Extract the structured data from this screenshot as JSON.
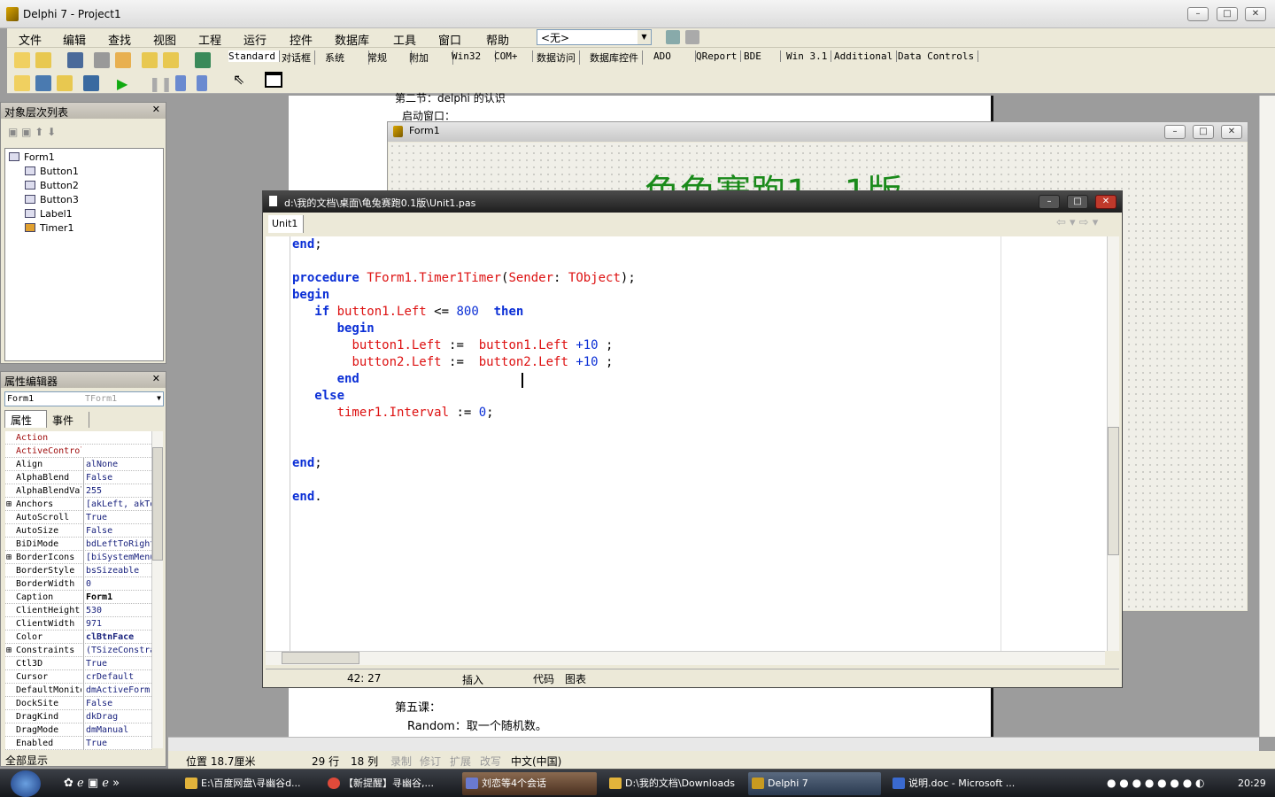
{
  "window": {
    "title": "Delphi 7 - Project1"
  },
  "menu": [
    "文件",
    "编辑",
    "查找",
    "视图",
    "工程",
    "运行",
    "控件",
    "数据库",
    "工具",
    "窗口",
    "帮助"
  ],
  "combo_value": "<无>",
  "palette_tabs": [
    "Standard",
    "对话框",
    "系统",
    "常规",
    "附加",
    "Win32",
    "COM+",
    "数据访问",
    "数据库控件",
    "ADO",
    "QReport",
    "BDE",
    "Win 3.1",
    "Additional",
    "Data Controls"
  ],
  "tree": {
    "title": "对象层次列表",
    "items": [
      "Form1",
      "Button1",
      "Button2",
      "Button3",
      "Label1",
      "Timer1"
    ]
  },
  "inspector": {
    "title": "属性编辑器",
    "object": "Form1",
    "object_type": "TForm1",
    "tabs": [
      "属性",
      "事件"
    ],
    "footer": "全部显示",
    "rows": [
      {
        "name": "Action",
        "value": "",
        "red": true
      },
      {
        "name": "ActiveControl",
        "value": "",
        "red": true
      },
      {
        "name": "Align",
        "value": "alNone"
      },
      {
        "name": "AlphaBlend",
        "value": "False"
      },
      {
        "name": "AlphaBlendValue",
        "value": "255"
      },
      {
        "name": "Anchors",
        "value": "[akLeft, akTop]",
        "plus": true
      },
      {
        "name": "AutoScroll",
        "value": "True"
      },
      {
        "name": "AutoSize",
        "value": "False"
      },
      {
        "name": "BiDiMode",
        "value": "bdLeftToRight"
      },
      {
        "name": "BorderIcons",
        "value": "[biSystemMenu]",
        "plus": true
      },
      {
        "name": "BorderStyle",
        "value": "bsSizeable"
      },
      {
        "name": "BorderWidth",
        "value": "0"
      },
      {
        "name": "Caption",
        "value": "Form1",
        "bold": true
      },
      {
        "name": "ClientHeight",
        "value": "530"
      },
      {
        "name": "ClientWidth",
        "value": "971"
      },
      {
        "name": "Color",
        "value": "clBtnFace",
        "bold": true
      },
      {
        "name": "Constraints",
        "value": "(TSizeConstraints)",
        "plus": true
      },
      {
        "name": "Ctl3D",
        "value": "True"
      },
      {
        "name": "Cursor",
        "value": "crDefault"
      },
      {
        "name": "DefaultMonitor",
        "value": "dmActiveForm"
      },
      {
        "name": "DockSite",
        "value": "False"
      },
      {
        "name": "DragKind",
        "value": "dkDrag"
      },
      {
        "name": "DragMode",
        "value": "dmManual"
      },
      {
        "name": "Enabled",
        "value": "True"
      }
    ]
  },
  "document": {
    "top_lines": [
      "第二节：delphi 的认识",
      "启动窗口："
    ],
    "bottom_lines": [
      "第五课：",
      "Random：取一个随机数。"
    ]
  },
  "form": {
    "title": "Form1",
    "label": "龟兔赛跑1．1版"
  },
  "editor": {
    "title": "d:\\我的文档\\桌面\\龟兔赛跑0.1版\\Unit1.pas",
    "tab": "Unit1",
    "position": "42: 27",
    "mode": "插入",
    "bottom_tabs": [
      "代码",
      "图表"
    ],
    "code": [
      [
        [
          "kw",
          "end"
        ],
        [
          "sy",
          ";"
        ]
      ],
      [],
      [
        [
          "kw",
          "procedure "
        ],
        [
          "id",
          "TForm1.Timer1Timer"
        ],
        [
          "sy",
          "("
        ],
        [
          "id",
          "Sender"
        ],
        [
          "sy",
          ": "
        ],
        [
          "id",
          "TObject"
        ],
        [
          "sy",
          ");"
        ]
      ],
      [
        [
          "kw",
          "begin"
        ]
      ],
      [
        [
          "sy",
          "   "
        ],
        [
          "kw",
          "if "
        ],
        [
          "id",
          "button1.Left "
        ],
        [
          "sy",
          "<= "
        ],
        [
          "nu",
          "800  "
        ],
        [
          "kw",
          "then"
        ]
      ],
      [
        [
          "sy",
          "      "
        ],
        [
          "kw",
          "begin"
        ]
      ],
      [
        [
          "sy",
          "        "
        ],
        [
          "id",
          "button1.Left "
        ],
        [
          "sy",
          ":=  "
        ],
        [
          "id",
          "button1.Left "
        ],
        [
          "nu",
          "+10 "
        ],
        [
          "sy",
          ";"
        ]
      ],
      [
        [
          "sy",
          "        "
        ],
        [
          "id",
          "button2.Left "
        ],
        [
          "sy",
          ":=  "
        ],
        [
          "id",
          "button2.Left "
        ],
        [
          "nu",
          "+10 "
        ],
        [
          "sy",
          ";"
        ]
      ],
      [
        [
          "sy",
          "      "
        ],
        [
          "kw",
          "end"
        ]
      ],
      [
        [
          "sy",
          "   "
        ],
        [
          "kw",
          "else"
        ]
      ],
      [
        [
          "sy",
          "      "
        ],
        [
          "id",
          "timer1.Interval "
        ],
        [
          "sy",
          ":= "
        ],
        [
          "nu",
          "0"
        ],
        [
          "sy",
          ";"
        ]
      ],
      [],
      [],
      [
        [
          "kw",
          "end"
        ],
        [
          "sy",
          ";"
        ]
      ],
      [],
      [
        [
          "kw",
          "end"
        ],
        [
          "sy",
          "."
        ]
      ]
    ]
  },
  "word_status": {
    "position": "位置 18.7厘米",
    "line": "29 行",
    "col": "18 列",
    "rec": "录制",
    "trk": "修订",
    "ext": "扩展",
    "ovr": "改写",
    "lang": "中文(中国)"
  },
  "taskbar": {
    "tasks": [
      "E:\\百度网盘\\寻幽谷d...",
      "【新提醒】寻幽谷,...",
      "刘恋等4个会话",
      "D:\\我的文档\\Downloads",
      "Delphi 7",
      "说明.doc - Microsoft ..."
    ],
    "clock": "20:29"
  }
}
